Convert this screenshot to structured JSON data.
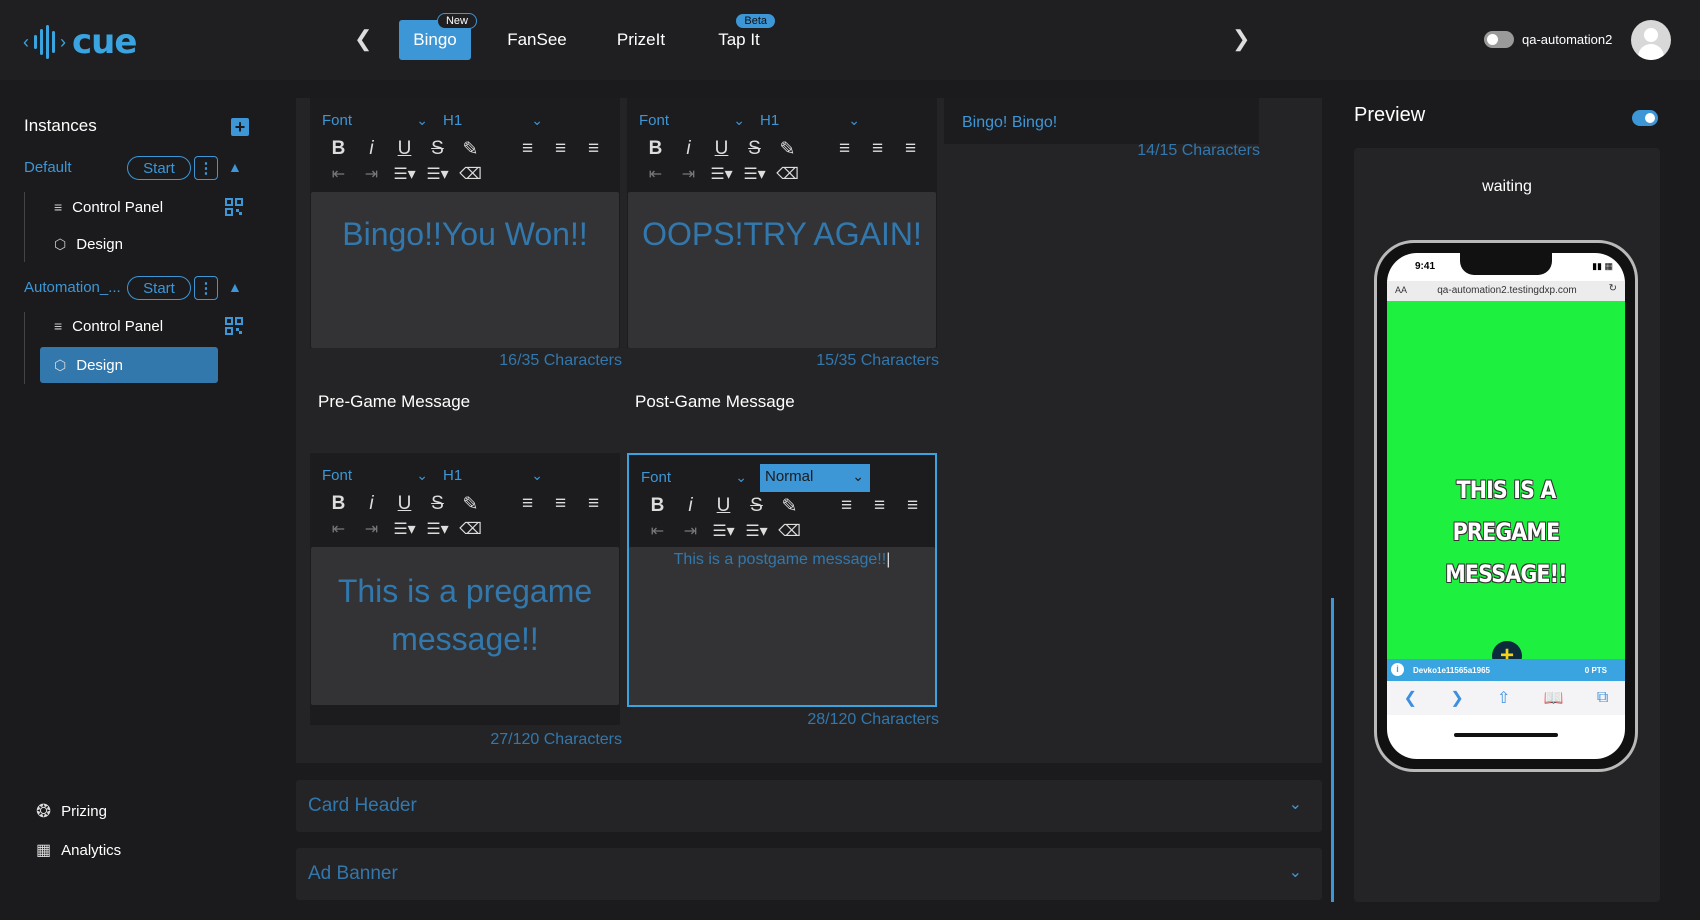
{
  "brand": {
    "logo_text": "cue"
  },
  "nav": {
    "tabs": [
      {
        "label": "Bingo",
        "badge": "New"
      },
      {
        "label": "FanSee"
      },
      {
        "label": "PrizeIt"
      },
      {
        "label": "Tap It",
        "badge": "Beta"
      }
    ],
    "prev_icon": "chevron-left-icon",
    "next_icon": "chevron-right-icon"
  },
  "user": {
    "name": "qa-automation2"
  },
  "sidebar": {
    "title": "Instances",
    "instances": [
      {
        "name": "Default",
        "start_label": "Start",
        "items": [
          "Control Panel",
          "Design"
        ]
      },
      {
        "name": "Automation_...",
        "start_label": "Start",
        "items": [
          "Control Panel",
          "Design"
        ],
        "active_item": "Design"
      }
    ],
    "footer": [
      {
        "label": "Prizing",
        "icon": "award-icon"
      },
      {
        "label": "Analytics",
        "icon": "bar-chart-icon"
      }
    ]
  },
  "editor": {
    "font_label": "Font",
    "heading_label": "H1",
    "normal_label": "Normal",
    "win_message": {
      "text": "Bingo!!You Won!!",
      "count": "16/35 Characters"
    },
    "lose_message": {
      "text": "OOPS!TRY AGAIN!",
      "count": "15/35 Characters"
    },
    "bingo_button": {
      "text": "Bingo! Bingo!",
      "count": "14/15 Characters"
    },
    "pregame": {
      "label": "Pre-Game Message",
      "text": "This is a pregame message!!",
      "count": "27/120 Characters"
    },
    "postgame": {
      "label": "Post-Game Message",
      "text": "This is a postgame message!!",
      "count": "28/120 Characters"
    }
  },
  "accordions": [
    {
      "label": "Card Header"
    },
    {
      "label": "Ad Banner"
    }
  ],
  "preview": {
    "title": "Preview",
    "status": "waiting",
    "phone": {
      "time": "9:41",
      "url_prefix": "AA",
      "url": "qa-automation2.testingdxp.com",
      "message": "THIS IS A PREGAME MESSAGE!!",
      "device_id": "Devko1e11565a1965",
      "points": "0 PTS",
      "bg_color": "#1ef03f"
    }
  },
  "colors": {
    "accent": "#3d96d6",
    "background": "#1b1b1d",
    "panel": "#242426"
  }
}
